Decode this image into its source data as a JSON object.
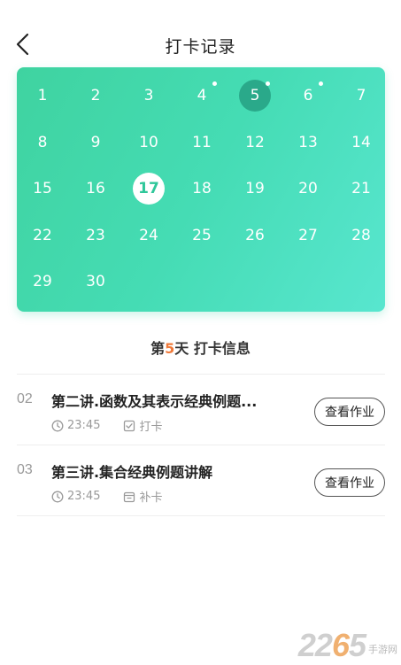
{
  "header": {
    "title": "打卡记录",
    "back_icon": "chevron-left-icon"
  },
  "calendar": {
    "today": 17,
    "selected": 5,
    "dotted_days": [
      4,
      5,
      6
    ],
    "days": [
      1,
      2,
      3,
      4,
      5,
      6,
      7,
      8,
      9,
      10,
      11,
      12,
      13,
      14,
      15,
      16,
      17,
      18,
      19,
      20,
      21,
      22,
      23,
      24,
      25,
      26,
      27,
      28,
      29,
      30
    ],
    "colors": {
      "gradient_start": "#3fd3a0",
      "gradient_end": "#58e6cf",
      "selected_bg": "#2aa98a",
      "today_text": "#2fc79a"
    }
  },
  "section": {
    "prefix": "第",
    "day_number": "5",
    "suffix": "天 打卡信息",
    "accent": "#f07a3a"
  },
  "records": [
    {
      "index": "02",
      "title": "第二讲.函数及其表示经典例题...",
      "time": "23:45",
      "status": "打卡",
      "status_icon": "checkbox-icon",
      "button": "查看作业"
    },
    {
      "index": "03",
      "title": "第三讲.集合经典例题讲解",
      "time": "23:45",
      "status": "补卡",
      "status_icon": "calendar-icon",
      "button": "查看作业"
    }
  ],
  "watermark": {
    "number_part1": "22",
    "number_part2": "6",
    "number_part3": "5",
    "text": "手游网"
  }
}
